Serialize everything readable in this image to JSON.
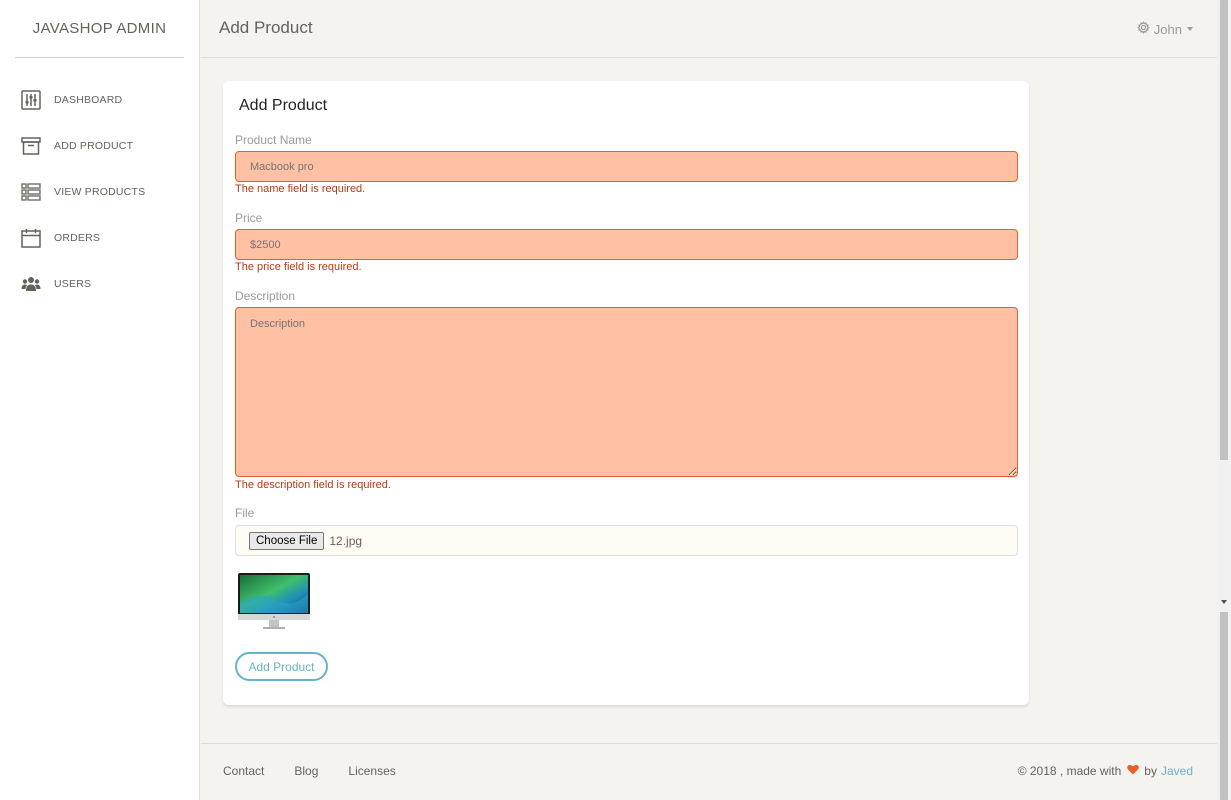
{
  "sidebar": {
    "brand": "JAVASHOP ADMIN",
    "items": [
      {
        "label": "DASHBOARD",
        "icon": "sliders-icon"
      },
      {
        "label": "ADD PRODUCT",
        "icon": "archive-icon"
      },
      {
        "label": "VIEW PRODUCTS",
        "icon": "list-icon"
      },
      {
        "label": "ORDERS",
        "icon": "calendar-icon"
      },
      {
        "label": "USERS",
        "icon": "users-icon"
      }
    ]
  },
  "header": {
    "title": "Add Product",
    "user_name": "John"
  },
  "form": {
    "title": "Add Product",
    "name": {
      "label": "Product Name",
      "placeholder": "Macbook pro",
      "error": "The name field is required."
    },
    "price": {
      "label": "Price",
      "placeholder": "$2500",
      "error": "The price field is required."
    },
    "description": {
      "label": "Description",
      "placeholder": "Description",
      "error": "The description field is required."
    },
    "file": {
      "label": "File",
      "button": "Choose File",
      "filename": "12.jpg"
    },
    "submit_label": "Add Product"
  },
  "footer": {
    "links": [
      "Contact",
      "Blog",
      "Licenses"
    ],
    "credit_prefix": "© 2018 , made with",
    "credit_by": "by",
    "author": "Javed"
  },
  "colors": {
    "accent": "#68b3c8",
    "danger": "#eb5e28",
    "error_bg": "#ffc0a4",
    "heart": "#eb5e28"
  }
}
